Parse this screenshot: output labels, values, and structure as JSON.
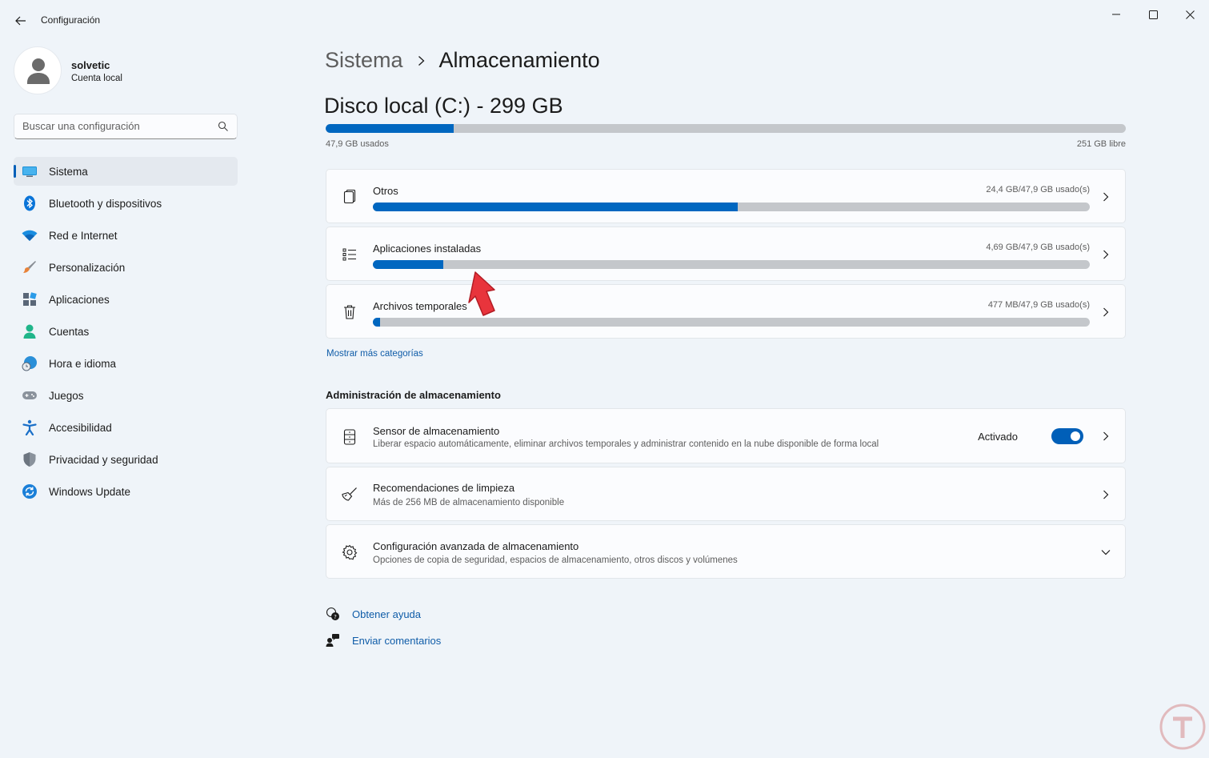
{
  "window": {
    "title": "Configuración",
    "back_icon": "back-arrow-icon",
    "controls": [
      "minimize-icon",
      "maximize-icon",
      "close-icon"
    ]
  },
  "profile": {
    "name": "solvetic",
    "account_type": "Cuenta local"
  },
  "search": {
    "placeholder": "Buscar una configuración",
    "icon": "search-icon"
  },
  "sidebar": {
    "items": [
      {
        "label": "Sistema",
        "icon": "system-icon",
        "active": true
      },
      {
        "label": "Bluetooth y dispositivos",
        "icon": "bluetooth-icon"
      },
      {
        "label": "Red e Internet",
        "icon": "wifi-icon"
      },
      {
        "label": "Personalización",
        "icon": "brush-icon"
      },
      {
        "label": "Aplicaciones",
        "icon": "apps-icon"
      },
      {
        "label": "Cuentas",
        "icon": "accounts-icon"
      },
      {
        "label": "Hora e idioma",
        "icon": "globe-clock-icon"
      },
      {
        "label": "Juegos",
        "icon": "gamepad-icon"
      },
      {
        "label": "Accesibilidad",
        "icon": "accessibility-icon"
      },
      {
        "label": "Privacidad y seguridad",
        "icon": "shield-icon"
      },
      {
        "label": "Windows Update",
        "icon": "update-icon"
      }
    ]
  },
  "breadcrumb": {
    "parent": "Sistema",
    "current": "Almacenamiento"
  },
  "disk": {
    "title": "Disco local (C:) - 299 GB",
    "used_label": "47,9 GB usados",
    "free_label": "251 GB libre",
    "used_fraction": 0.16
  },
  "categories": [
    {
      "title": "Otros",
      "usage": "24,4 GB/47,9 GB usado(s)",
      "fraction": 0.509,
      "icon": "other-files-icon"
    },
    {
      "title": "Aplicaciones instaladas",
      "usage": "4,69 GB/47,9 GB usado(s)",
      "fraction": 0.098,
      "icon": "list-icon"
    },
    {
      "title": "Archivos temporales",
      "usage": "477 MB/47,9 GB usado(s)",
      "fraction": 0.01,
      "icon": "trash-icon"
    }
  ],
  "more_categories_link": "Mostrar más categorías",
  "management": {
    "section_title": "Administración de almacenamiento",
    "sensor": {
      "title": "Sensor de almacenamiento",
      "subtitle": "Liberar espacio automáticamente, eliminar archivos temporales y administrar contenido en la nube disponible de forma local",
      "toggle_label": "Activado",
      "toggle_on": true,
      "icon": "storage-sense-icon"
    },
    "cleanup": {
      "title": "Recomendaciones de limpieza",
      "subtitle": "Más de 256 MB de almacenamiento disponible",
      "icon": "broom-icon"
    },
    "advanced": {
      "title": "Configuración avanzada de almacenamiento",
      "subtitle": "Opciones de copia de seguridad, espacios de almacenamiento, otros discos y volúmenes",
      "icon": "gear-icon"
    }
  },
  "help": {
    "get_help": "Obtener ayuda",
    "feedback": "Enviar comentarios"
  },
  "colors": {
    "accent": "#005fb8",
    "bar_fill": "#0067c0",
    "bar_track": "#c4c7cb",
    "background": "#eff4f9",
    "card": "#fbfcfe",
    "annotation_arrow": "#e8343c"
  }
}
